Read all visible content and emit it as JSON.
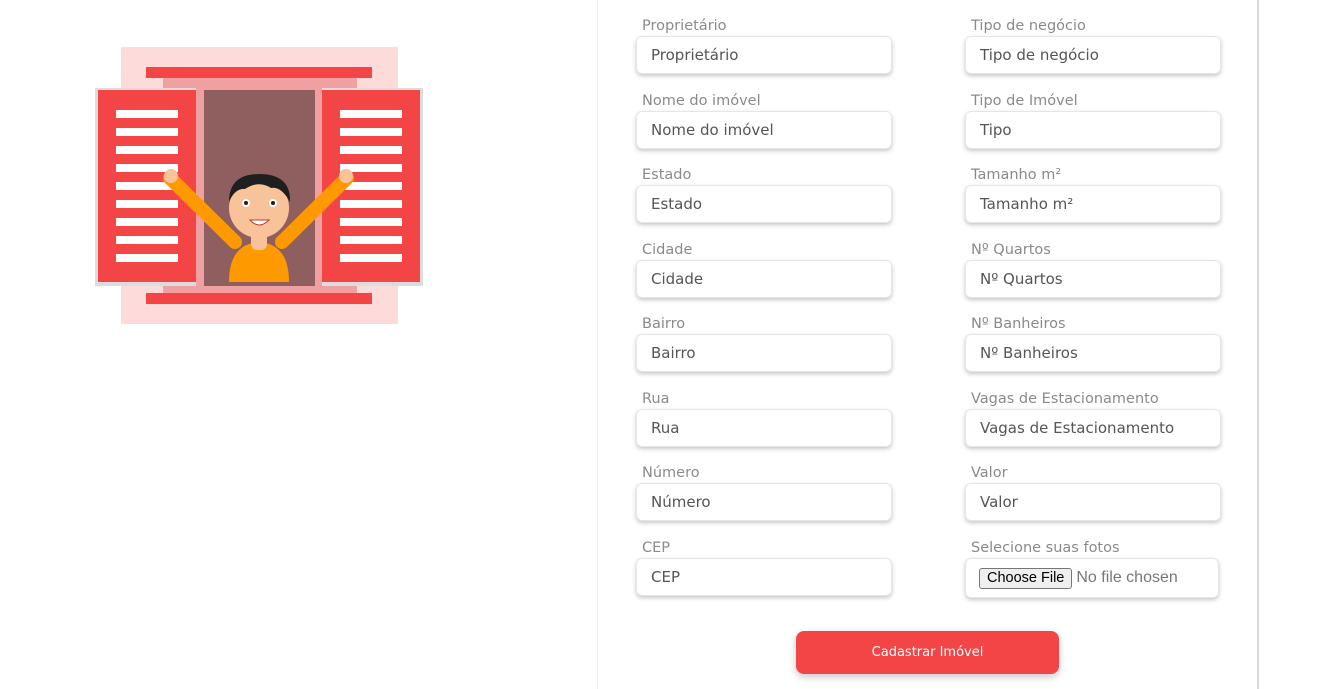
{
  "form": {
    "left_fields": [
      {
        "label": "Proprietário",
        "placeholder": "Proprietário"
      },
      {
        "label": "Nome do imóvel",
        "placeholder": "Nome do imóvel"
      },
      {
        "label": "Estado",
        "placeholder": "Estado"
      },
      {
        "label": "Cidade",
        "placeholder": "Cidade"
      },
      {
        "label": "Bairro",
        "placeholder": "Bairro"
      },
      {
        "label": "Rua",
        "placeholder": "Rua"
      },
      {
        "label": "Número",
        "placeholder": "Número"
      },
      {
        "label": "CEP",
        "placeholder": "CEP"
      }
    ],
    "right_fields": [
      {
        "label": "Tipo de negócio",
        "placeholder": "Tipo de negócio"
      },
      {
        "label": "Tipo de Imóvel",
        "placeholder": "Tipo"
      },
      {
        "label": "Tamanho m²",
        "placeholder": "Tamanho m²"
      },
      {
        "label": "Nº Quartos",
        "placeholder": "Nº Quartos"
      },
      {
        "label": "Nº Banheiros",
        "placeholder": "Nº Banheiros"
      },
      {
        "label": "Vagas de Estacionamento",
        "placeholder": "Vagas de Estacionamento"
      },
      {
        "label": "Valor",
        "placeholder": "Valor"
      }
    ],
    "photos": {
      "label": "Selecione suas fotos",
      "button_label": "Choose File",
      "status": "No file chosen"
    },
    "submit_label": "Cadastrar Imóvel"
  },
  "illustration": {
    "subject": "person-waving-at-window",
    "colors": {
      "backdrop": "#fddbdb",
      "shutter": "#f34545",
      "window_frame": "#f0a0a0",
      "window_interior": "#8f5e5e",
      "shirt": "#ff9900",
      "skin": "#f9c39a",
      "hair": "#1f1f1f"
    }
  },
  "colors": {
    "accent": "#f34545",
    "label": "#8a8a8a",
    "input_text": "#555555"
  }
}
